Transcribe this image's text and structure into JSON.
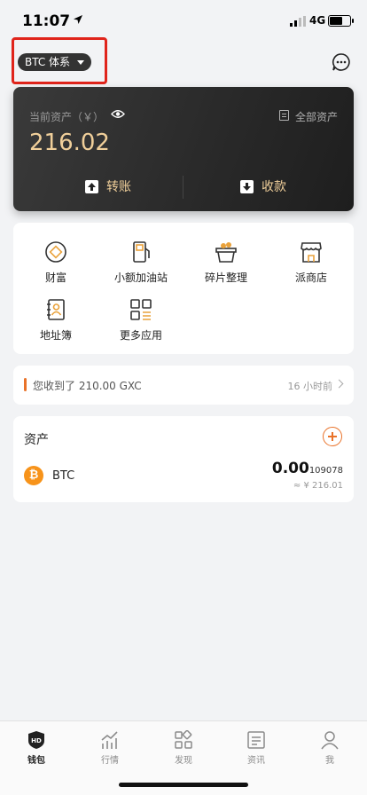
{
  "status_bar": {
    "time": "11:07",
    "network": "4G"
  },
  "header": {
    "system_label": "BTC 体系"
  },
  "asset_card": {
    "label": "当前资产（￥）",
    "amount": "216.02",
    "all_assets_label": "全部资产",
    "transfer_label": "转账",
    "receive_label": "收款"
  },
  "apps": [
    {
      "label": "财富",
      "icon": "wealth-icon"
    },
    {
      "label": "小额加油站",
      "icon": "gas-station-icon"
    },
    {
      "label": "碎片整理",
      "icon": "basket-icon"
    },
    {
      "label": "派商店",
      "icon": "store-icon"
    },
    {
      "label": "地址簿",
      "icon": "address-book-icon"
    },
    {
      "label": "更多应用",
      "icon": "more-apps-icon"
    }
  ],
  "notice": {
    "text": "您收到了 210.00 GXC",
    "time_ago": "16 小时前"
  },
  "assets": {
    "title": "资产",
    "items": [
      {
        "symbol": "BTC",
        "balance_main": "0.00",
        "balance_small": "109078",
        "fiat": "≈ ¥ 216.01"
      }
    ]
  },
  "tabbar": [
    {
      "label": "钱包",
      "icon": "wallet-hd-icon",
      "active": true
    },
    {
      "label": "行情",
      "icon": "chart-icon",
      "active": false
    },
    {
      "label": "发现",
      "icon": "discover-icon",
      "active": false
    },
    {
      "label": "资讯",
      "icon": "news-icon",
      "active": false
    },
    {
      "label": "我",
      "icon": "profile-icon",
      "active": false
    }
  ],
  "colors": {
    "accent": "#e9732a",
    "gold": "#f0cf9a",
    "highlight": "#e0241b",
    "btc": "#f7931a"
  }
}
